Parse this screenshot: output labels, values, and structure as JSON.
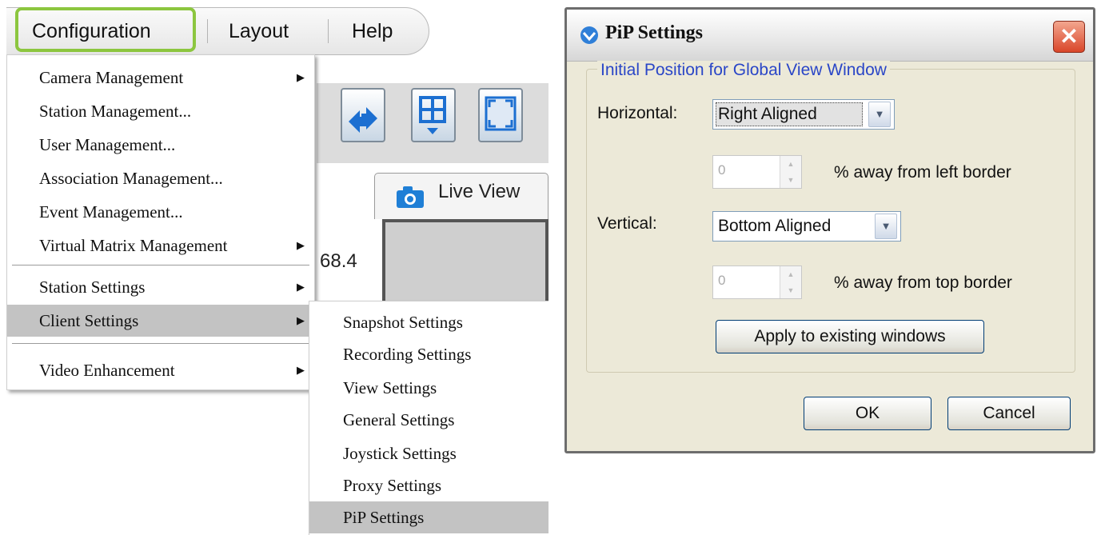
{
  "menubar": {
    "items": [
      "Configuration",
      "Layout",
      "Help"
    ]
  },
  "workspace": {
    "tab_label": "Live View",
    "ip_fragment": "68.4"
  },
  "config_menu": {
    "items": [
      {
        "label": "Camera Management",
        "submenu": true
      },
      {
        "label": "Station Management...",
        "submenu": false
      },
      {
        "label": "User Management...",
        "submenu": false
      },
      {
        "label": "Association Management...",
        "submenu": false
      },
      {
        "label": "Event Management...",
        "submenu": false
      },
      {
        "label": "Virtual Matrix Management",
        "submenu": true
      },
      {
        "label": "Station Settings",
        "submenu": true
      },
      {
        "label": "Client Settings",
        "submenu": true,
        "selected": true
      },
      {
        "label": "Video Enhancement",
        "submenu": true
      }
    ]
  },
  "client_settings_menu": {
    "items": [
      {
        "label": "Snapshot Settings"
      },
      {
        "label": "Recording Settings"
      },
      {
        "label": "View Settings"
      },
      {
        "label": "General Settings"
      },
      {
        "label": "Joystick Settings"
      },
      {
        "label": "Proxy Settings"
      },
      {
        "label": "PiP Settings",
        "selected": true
      }
    ]
  },
  "dialog": {
    "title": "PiP Settings",
    "group_title": "Initial Position for Global View Window",
    "horizontal_label": "Horizontal:",
    "horizontal_value": "Right Aligned",
    "horizontal_offset_value": "0",
    "horizontal_offset_suffix": "% away from left border",
    "vertical_label": "Vertical:",
    "vertical_value": "Bottom Aligned",
    "vertical_offset_value": "0",
    "vertical_offset_suffix": "% away from top border",
    "apply_label": "Apply to existing windows",
    "ok_label": "OK",
    "cancel_label": "Cancel"
  },
  "colors": {
    "highlight_frame": "#8cc63f",
    "group_title": "#2a46c7",
    "menu_selection": "#c3c3c3"
  }
}
